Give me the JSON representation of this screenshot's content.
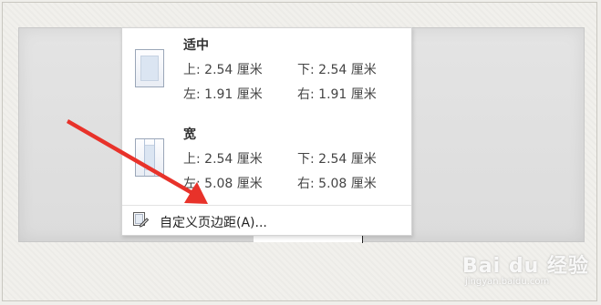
{
  "margins_menu": {
    "presets": [
      {
        "name": "适中",
        "top": "上: 2.54 厘米",
        "bottom": "下: 2.54 厘米",
        "left": "左: 1.91 厘米",
        "right": "右: 1.91 厘米"
      },
      {
        "name": "宽",
        "top": "上: 2.54 厘米",
        "bottom": "下: 2.54 厘米",
        "left": "左: 5.08 厘米",
        "right": "右: 5.08 厘米"
      }
    ],
    "custom_label": "自定义页边距(A)..."
  },
  "watermark": {
    "brand": "Bai du 经验",
    "url": "jingyan.baidu.com"
  },
  "colors": {
    "arrow": "#e8322a",
    "thumb_border": "#9aa6b8"
  }
}
